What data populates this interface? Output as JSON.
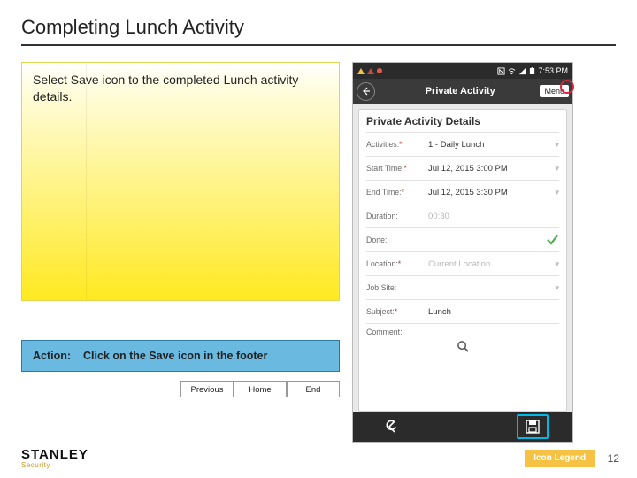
{
  "title": "Completing Lunch Activity",
  "instruction": "Select Save icon to the completed Lunch activity details.",
  "action_label": "Action:",
  "action_text": "Click on the Save icon in the footer",
  "nav": {
    "prev": "Previous",
    "home": "Home",
    "end": "End"
  },
  "phone": {
    "status_time": "7:53 PM",
    "appbar_title": "Private Activity",
    "appbar_menu": "Menu",
    "card_title": "Private Activity Details",
    "fields": {
      "activities": {
        "label": "Activities:",
        "value": "1 - Daily Lunch"
      },
      "start": {
        "label": "Start Time:",
        "value": "Jul 12, 2015 3:00 PM"
      },
      "end": {
        "label": "End Time:",
        "value": "Jul 12, 2015 3:30 PM"
      },
      "duration": {
        "label": "Duration:",
        "value": "00:30"
      },
      "done": {
        "label": "Done:"
      },
      "location": {
        "label": "Location:",
        "value": "Current Location"
      },
      "jobsite": {
        "label": "Job Site:",
        "value": ""
      },
      "subject": {
        "label": "Subject:",
        "value": "Lunch"
      },
      "comment": {
        "label": "Comment:"
      }
    }
  },
  "footer": {
    "brand": "STANLEY",
    "brand_sub": "Security",
    "legend": "Icon Legend",
    "page": "12"
  }
}
